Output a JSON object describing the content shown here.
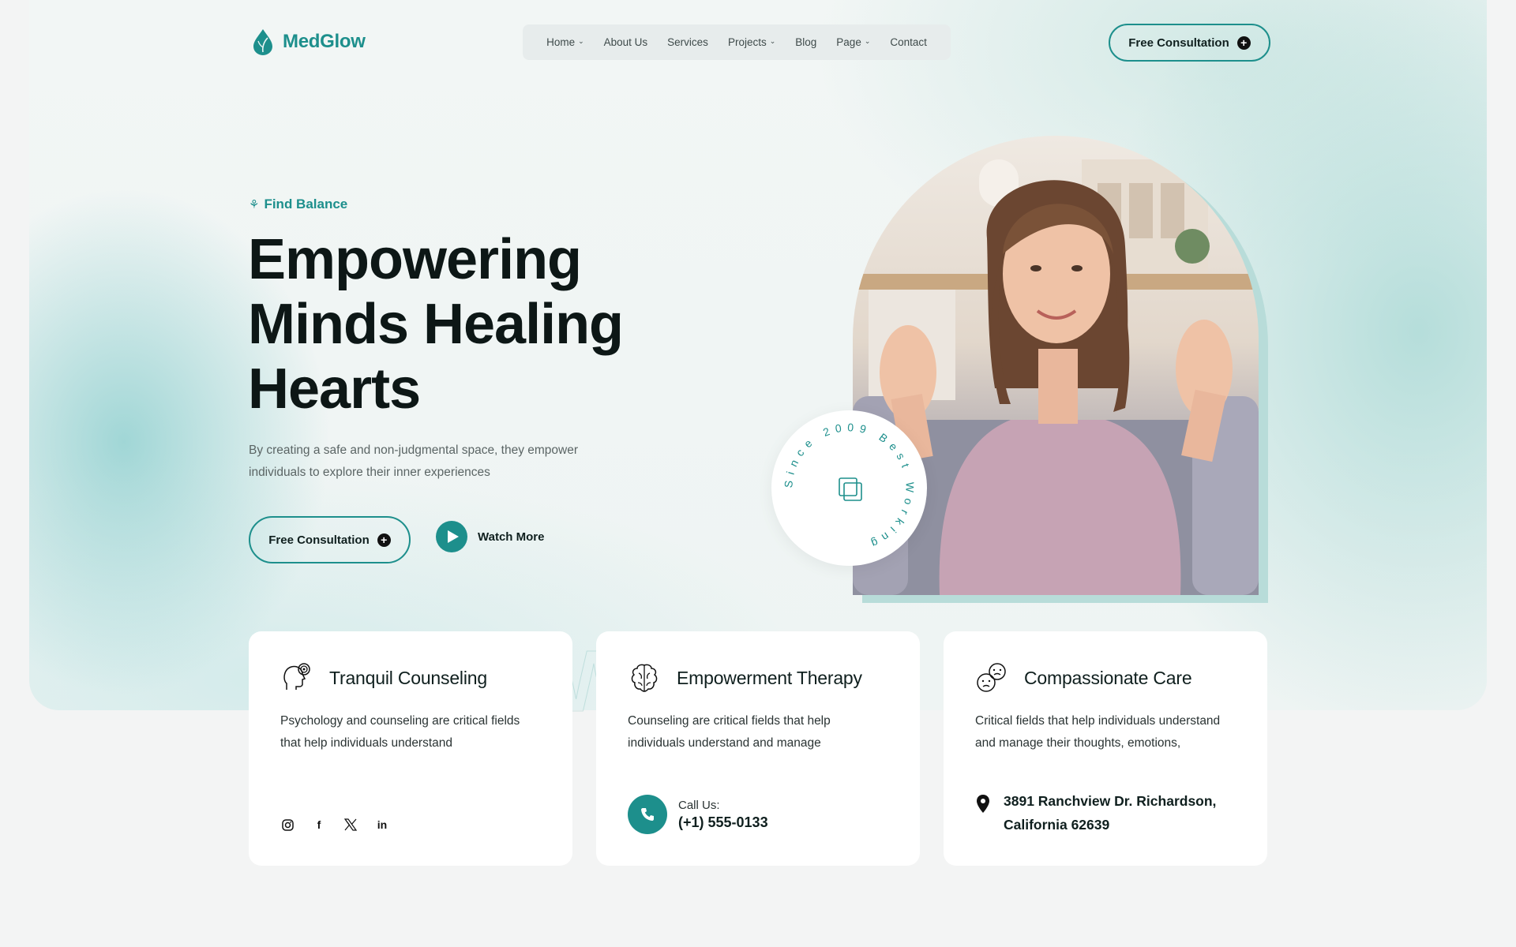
{
  "brand": {
    "name": "MedGlow",
    "accent": "#1d8f8c"
  },
  "nav": {
    "items": [
      {
        "label": "Home",
        "has_dropdown": true
      },
      {
        "label": "About Us",
        "has_dropdown": false
      },
      {
        "label": "Services",
        "has_dropdown": false
      },
      {
        "label": "Projects",
        "has_dropdown": true
      },
      {
        "label": "Blog",
        "has_dropdown": false
      },
      {
        "label": "Page",
        "has_dropdown": true
      },
      {
        "label": "Contact",
        "has_dropdown": false
      }
    ],
    "cta_label": "Free Consultation"
  },
  "hero": {
    "eyebrow": "Find Balance",
    "title_lines": [
      "Empowering",
      "Minds Healing",
      "Hearts"
    ],
    "description": "By creating a safe and non-judgmental space, they empower individuals to explore their inner experiences",
    "primary_cta": "Free Consultation",
    "secondary_cta": "Watch More",
    "badge_text": "Since 2009 Best Working"
  },
  "cards": [
    {
      "title": "Tranquil Counseling",
      "icon": "head-mind-icon",
      "text": "Psychology and counseling are critical fields that help individuals understand",
      "socials": [
        "instagram-icon",
        "facebook-icon",
        "x-icon",
        "linkedin-icon"
      ]
    },
    {
      "title": "Empowerment Therapy",
      "icon": "brain-icon",
      "text": "Counseling are critical fields that help individuals understand and manage",
      "call_label": "Call Us:",
      "call_number": "(+1) 555-0133"
    },
    {
      "title": "Compassionate Care",
      "icon": "emotions-faces-icon",
      "text": "Critical fields that help individuals understand and manage their thoughts, emotions,",
      "address_line1": "3891 Ranchview Dr. Richardson,",
      "address_line2": "California 62639"
    }
  ]
}
